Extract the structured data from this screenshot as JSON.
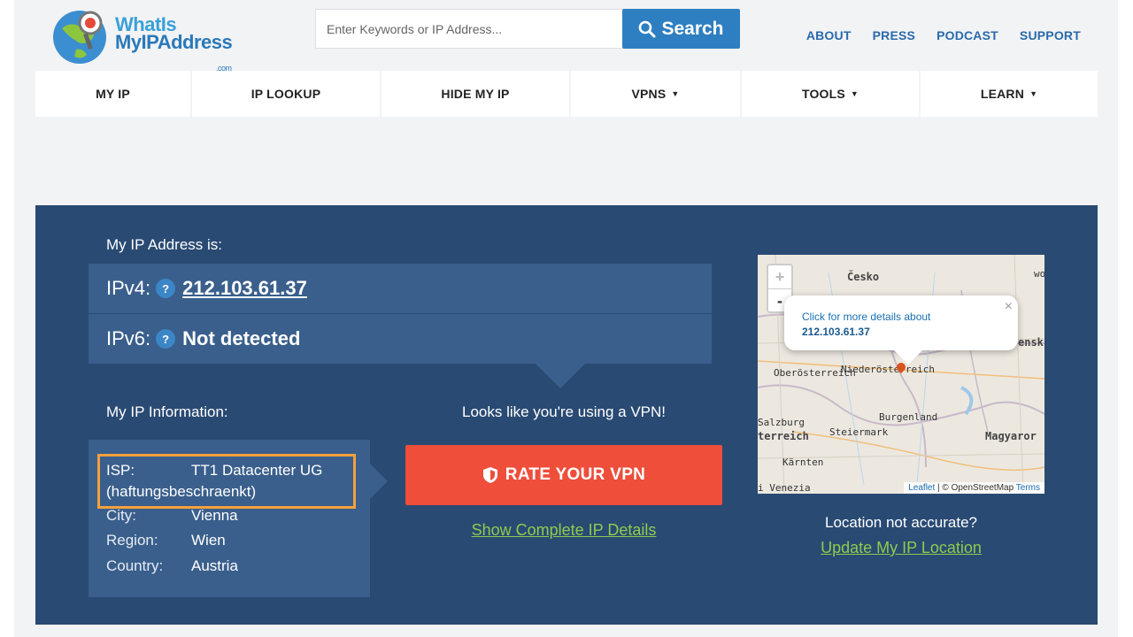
{
  "logo": {
    "line1": "WhatIs",
    "line2": "MyIPAddress",
    "suffix": ".com"
  },
  "search": {
    "placeholder": "Enter Keywords or IP Address...",
    "button_label": "Search"
  },
  "top_links": [
    "ABOUT",
    "PRESS",
    "PODCAST",
    "SUPPORT"
  ],
  "nav": [
    {
      "label": "MY IP",
      "dropdown": false
    },
    {
      "label": "IP LOOKUP",
      "dropdown": false
    },
    {
      "label": "HIDE MY IP",
      "dropdown": false
    },
    {
      "label": "VPNS",
      "dropdown": true
    },
    {
      "label": "TOOLS",
      "dropdown": true
    },
    {
      "label": "LEARN",
      "dropdown": true
    }
  ],
  "ip": {
    "heading": "My IP Address is:",
    "ipv4_label": "IPv4:",
    "ipv4_value": "212.103.61.37",
    "ipv6_label": "IPv6:",
    "ipv6_value": "Not detected",
    "help_glyph": "?"
  },
  "info": {
    "heading": "My IP Information:",
    "isp_label": "ISP:",
    "isp_value": "TT1 Datacenter UG (haftungsbeschraenkt)",
    "city_label": "City:",
    "city_value": "Vienna",
    "region_label": "Region:",
    "region_value": "Wien",
    "country_label": "Country:",
    "country_value": "Austria"
  },
  "vpn": {
    "message": "Looks like you're using a VPN!",
    "button_label": "RATE YOUR VPN",
    "details_link": "Show Complete IP Details"
  },
  "map": {
    "zoom_in": "+",
    "zoom_out": "-",
    "popup_text": "Click for more details about",
    "popup_ip": "212.103.61.37",
    "popup_close": "×",
    "labels": {
      "cesko": "Česko",
      "oberosterreich": "Oberösterreich",
      "niederosterreich": "Niederösterreich",
      "burgenland": "Burgenland",
      "steiermark": "Steiermark",
      "salzburg": "Salzburg",
      "terreich": "terreich",
      "karnten": "Kärnten",
      "magyaror": "Magyaror",
      "venezia": "i Venezia",
      "ensk": "ensk",
      "wo": "wo"
    },
    "attribution_leaflet": "Leaflet",
    "attribution_osm": " | © OpenStreetMap ",
    "attribution_terms": "Terms"
  },
  "location": {
    "question": "Location not accurate?",
    "update_link": "Update My IP Location"
  },
  "colors": {
    "panel": "#294a73",
    "row": "#3a5f8c",
    "accent_red": "#ee4e3a",
    "link_green": "#8fcb4e",
    "highlight": "#f5a03c"
  }
}
